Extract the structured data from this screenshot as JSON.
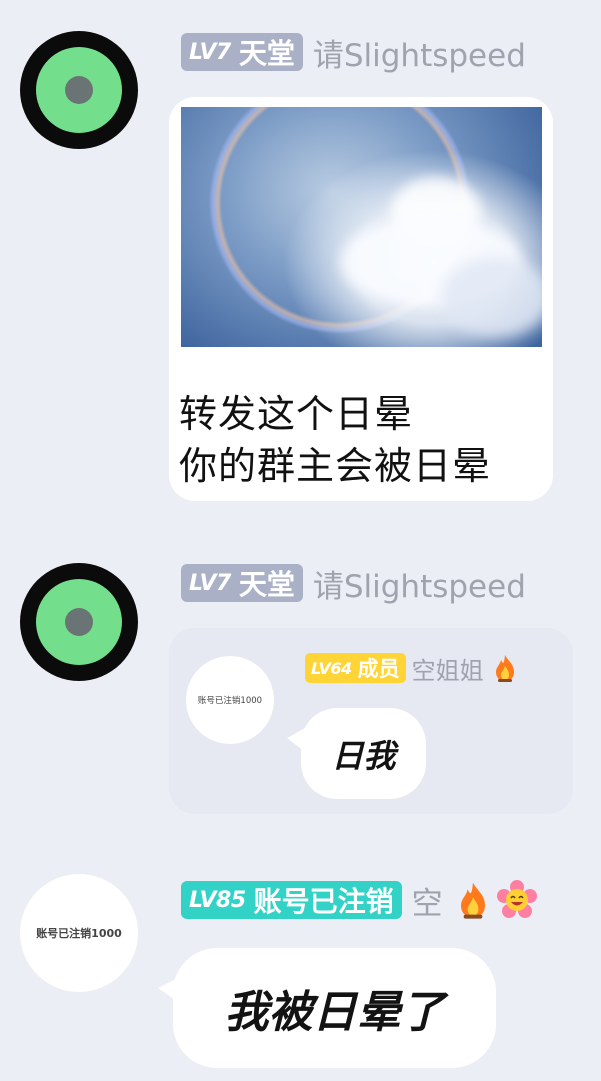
{
  "messages": [
    {
      "user": {
        "level": "LV7",
        "title": "天堂",
        "nickname": "请Slightspeed",
        "avatar": "green-ring-avatar"
      },
      "image": {
        "description_icon": "halo-sky-photo"
      },
      "caption_lines": [
        "转发这个日晕",
        "你的群主会被日晕"
      ]
    },
    {
      "user": {
        "level": "LV7",
        "title": "天堂",
        "nickname": "请Slightspeed",
        "avatar": "green-ring-avatar"
      },
      "quoted": {
        "user": {
          "level": "LV64",
          "title": "成员",
          "nickname": "空姐姐",
          "avatar_text": "账号已注销1000",
          "icons": [
            "fire-icon"
          ]
        },
        "text": "日我"
      }
    },
    {
      "user": {
        "level": "LV85",
        "title": "账号已注销",
        "nickname": "空",
        "avatar_text": "账号已注销1000",
        "icons": [
          "fire-icon",
          "flower-emoji-icon"
        ]
      },
      "text": "我被日晕了"
    }
  ],
  "colors": {
    "background": "#eceef6",
    "badge_gray": "#aab1c6",
    "badge_teal": "#33d2c7",
    "badge_yellow": "#ffd436",
    "nickname": "#9fa3ae"
  }
}
